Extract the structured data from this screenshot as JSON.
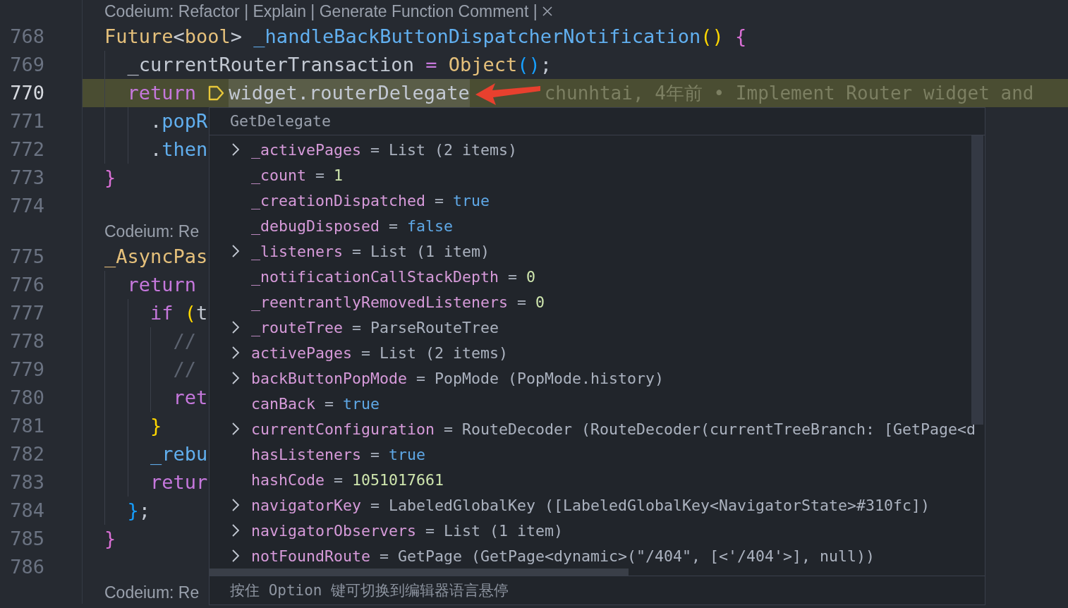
{
  "editor": {
    "lines": [
      {
        "kind": "lens",
        "text": "Codeium: Refactor | Explain | Generate Function Comment |",
        "closable": true
      },
      {
        "kind": "code",
        "number": "768",
        "highlighted": false,
        "tokens": [
          {
            "text": "Future",
            "kind": "type"
          },
          {
            "text": "<",
            "kind": "plain"
          },
          {
            "text": "bool",
            "kind": "type"
          },
          {
            "text": "> ",
            "kind": "plain"
          },
          {
            "text": "_handleBackButtonDispatcherNotification",
            "kind": "function"
          },
          {
            "text": "()",
            "kind": "bracket_yellow"
          },
          {
            "text": " {",
            "kind": "bracket_purple"
          }
        ],
        "children": [
          {
            "kind": "code",
            "number": "769",
            "highlighted": false,
            "tokens": [
              {
                "text": "_currentRouterTransaction",
                "kind": "plain"
              },
              {
                "text": " = ",
                "kind": "operator"
              },
              {
                "text": "Object",
                "kind": "type"
              },
              {
                "text": "()",
                "kind": "bracket_blue"
              },
              {
                "text": ";",
                "kind": "plain"
              }
            ]
          },
          {
            "kind": "code",
            "number": "770",
            "highlighted": true,
            "execution_marker": true,
            "tokens": [
              {
                "text": "return",
                "kind": "keyword"
              },
              {
                "text": "widget.routerDelegate",
                "kind": "hovered"
              }
            ],
            "blame": "chunhtai, 4年前 • Implement Router widget and",
            "children": [
              {
                "kind": "code",
                "number": "771",
                "highlighted": false,
                "tokens": [
                  {
                    "text": ".",
                    "kind": "plain"
                  },
                  {
                    "text": "popR",
                    "kind": "function"
                  }
                ]
              },
              {
                "kind": "code",
                "number": "772",
                "highlighted": false,
                "tokens": [
                  {
                    "text": ".",
                    "kind": "plain"
                  },
                  {
                    "text": "then",
                    "kind": "function"
                  }
                ]
              }
            ]
          }
        ]
      },
      {
        "kind": "code",
        "number": "773",
        "highlighted": false,
        "tokens": [
          {
            "text": "}",
            "kind": "bracket_purple"
          }
        ]
      },
      {
        "kind": "code",
        "number": "774",
        "highlighted": false
      },
      {
        "kind": "lens",
        "text": "Codeium: Re",
        "closable": false
      },
      {
        "kind": "code",
        "number": "775",
        "highlighted": false,
        "tokens": [
          {
            "text": "_AsyncPas",
            "kind": "type"
          }
        ],
        "children": [
          {
            "kind": "code",
            "number": "776",
            "highlighted": false,
            "tokens": [
              {
                "text": "return",
                "kind": "keyword"
              }
            ],
            "children": [
              {
                "kind": "code",
                "number": "777",
                "highlighted": false,
                "tokens": [
                  {
                    "text": "if",
                    "kind": "keyword"
                  },
                  {
                    "text": "(",
                    "kind": "bracket_yellow"
                  },
                  {
                    "text": "t",
                    "kind": "plain"
                  }
                ],
                "children": [
                  {
                    "kind": "code",
                    "number": "778",
                    "highlighted": false,
                    "tokens": [
                      {
                        "text": "//",
                        "kind": "comment"
                      }
                    ]
                  },
                  {
                    "kind": "code",
                    "number": "779",
                    "highlighted": false,
                    "tokens": [
                      {
                        "text": "//",
                        "kind": "comment"
                      }
                    ]
                  },
                  {
                    "kind": "code",
                    "number": "780",
                    "highlighted": false,
                    "tokens": [
                      {
                        "text": "ret",
                        "kind": "keyword"
                      }
                    ]
                  }
                ]
              },
              {
                "kind": "code",
                "number": "781",
                "highlighted": false,
                "tokens": [
                  {
                    "text": "}",
                    "kind": "bracket_yellow"
                  }
                ]
              },
              {
                "kind": "code",
                "number": "782",
                "highlighted": false,
                "tokens": [
                  {
                    "text": "_rebu",
                    "kind": "function"
                  }
                ]
              },
              {
                "kind": "code",
                "number": "783",
                "highlighted": false,
                "tokens": [
                  {
                    "text": "retur",
                    "kind": "keyword"
                  }
                ]
              }
            ]
          },
          {
            "kind": "code",
            "number": "784",
            "highlighted": false,
            "tokens": [
              {
                "text": "}",
                "kind": "bracket_blue"
              },
              {
                "text": ";",
                "kind": "plain"
              }
            ]
          }
        ]
      },
      {
        "kind": "code",
        "number": "785",
        "highlighted": false,
        "tokens": [
          {
            "text": "}",
            "kind": "bracket_purple"
          }
        ]
      },
      {
        "kind": "code",
        "number": "786",
        "highlighted": false
      },
      {
        "kind": "lens",
        "text": "Codeium: Re",
        "closable": false
      }
    ]
  },
  "hover": {
    "title": "GetDelegate",
    "rows": [
      {
        "name": "_activePages",
        "operator": "=",
        "value": "List (2 items)",
        "color": "#abb2bf",
        "expandable": true
      },
      {
        "name": "_count",
        "operator": "=",
        "value": "1",
        "color": "#cfe6ae",
        "expandable": false
      },
      {
        "name": "_creationDispatched",
        "operator": "=",
        "value": "true",
        "color": "#5fa8e6",
        "expandable": false
      },
      {
        "name": "_debugDisposed",
        "operator": "=",
        "value": "false",
        "color": "#5fa8e6",
        "expandable": false
      },
      {
        "name": "_listeners",
        "operator": "=",
        "value": "List (1 item)",
        "color": "#abb2bf",
        "expandable": true
      },
      {
        "name": "_notificationCallStackDepth",
        "operator": "=",
        "value": "0",
        "color": "#cfe6ae",
        "expandable": false
      },
      {
        "name": "_reentrantlyRemovedListeners",
        "operator": "=",
        "value": "0",
        "color": "#cfe6ae",
        "expandable": false
      },
      {
        "name": "_routeTree",
        "operator": "=",
        "value": "ParseRouteTree",
        "color": "#abb2bf",
        "expandable": true
      },
      {
        "name": "activePages",
        "operator": "=",
        "value": "List (2 items)",
        "color": "#abb2bf",
        "expandable": true
      },
      {
        "name": "backButtonPopMode",
        "operator": "=",
        "value": "PopMode (PopMode.history)",
        "color": "#abb2bf",
        "expandable": true
      },
      {
        "name": "canBack",
        "operator": "=",
        "value": "true",
        "color": "#5fa8e6",
        "expandable": false
      },
      {
        "name": "currentConfiguration",
        "operator": "=",
        "value": "RouteDecoder (RouteDecoder(currentTreeBranch: [GetPage<d",
        "color": "#abb2bf",
        "expandable": true
      },
      {
        "name": "hasListeners",
        "operator": "=",
        "value": "true",
        "color": "#5fa8e6",
        "expandable": false
      },
      {
        "name": "hashCode",
        "operator": "=",
        "value": "1051017661",
        "color": "#cfe6ae",
        "expandable": false
      },
      {
        "name": "navigatorKey",
        "operator": "=",
        "value": "LabeledGlobalKey ([LabeledGlobalKey<NavigatorState>#310fc])",
        "color": "#abb2bf",
        "expandable": true
      },
      {
        "name": "navigatorObservers",
        "operator": "=",
        "value": "List (1 item)",
        "color": "#abb2bf",
        "expandable": true
      },
      {
        "name": "notFoundRoute",
        "operator": "=",
        "value": "GetPage (GetPage<dynamic>(\"/404\", [<'/404'>], null))",
        "color": "#abb2bf",
        "expandable": true
      }
    ],
    "footer": "按住 Option 键可切换到编辑器语言悬停"
  }
}
